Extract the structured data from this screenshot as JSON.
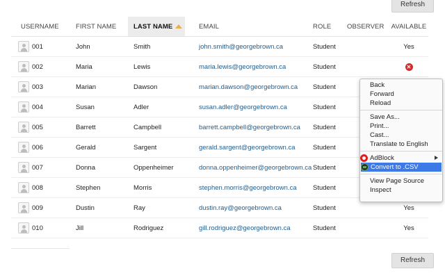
{
  "buttons": {
    "refresh_top": "Refresh",
    "refresh_bottom": "Refresh"
  },
  "table": {
    "headers": {
      "username": "USERNAME",
      "first_name": "FIRST NAME",
      "last_name": "LAST NAME",
      "email": "EMAIL",
      "role": "ROLE",
      "observer": "OBSERVER",
      "available": "AVAILABLE"
    },
    "sorted_column": "last_name",
    "rows": [
      {
        "username": "001",
        "first": "John",
        "last": "Smith",
        "email": "john.smith@georgebrown.ca",
        "role": "Student",
        "observer": "",
        "available": "Yes"
      },
      {
        "username": "002",
        "first": "Maria",
        "last": "Lewis",
        "email": "maria.lewis@georgebrown.ca",
        "role": "Student",
        "observer": "",
        "available": "x-icon"
      },
      {
        "username": "003",
        "first": "Marian",
        "last": "Dawson",
        "email": "marian.dawson@georgebrown.ca",
        "role": "Student",
        "observer": "",
        "available": ""
      },
      {
        "username": "004",
        "first": "Susan",
        "last": "Adler",
        "email": "susan.adler@georgebrown.ca",
        "role": "Student",
        "observer": "",
        "available": ""
      },
      {
        "username": "005",
        "first": "Barrett",
        "last": "Campbell",
        "email": "barrett.campbell@georgebrown.ca",
        "role": "Student",
        "observer": "",
        "available": ""
      },
      {
        "username": "006",
        "first": "Gerald",
        "last": "Sargent",
        "email": "gerald.sargent@georgebrown.ca",
        "role": "Student",
        "observer": "",
        "available": ""
      },
      {
        "username": "007",
        "first": "Donna",
        "last": "Oppenheimer",
        "email": "donna.oppenheimer@georgebrown.ca",
        "role": "Student",
        "observer": "",
        "available": ""
      },
      {
        "username": "008",
        "first": "Stephen",
        "last": "Morris",
        "email": "stephen.morris@georgebrown.ca",
        "role": "Student",
        "observer": "",
        "available": ""
      },
      {
        "username": "009",
        "first": "Dustin",
        "last": "Ray",
        "email": "dustin.ray@georgebrown.ca",
        "role": "Student",
        "observer": "",
        "available": "Yes"
      },
      {
        "username": "010",
        "first": "Jill",
        "last": "Rodriguez",
        "email": "gill.rodriguez@georgebrown.ca",
        "role": "Student",
        "observer": "",
        "available": "Yes"
      }
    ]
  },
  "context_menu": {
    "back": "Back",
    "forward": "Forward",
    "reload": "Reload",
    "save_as": "Save As...",
    "print": "Print...",
    "cast": "Cast...",
    "translate": "Translate to English",
    "adblock": "AdBlock",
    "convert_csv": "Convert to .CSV",
    "view_source": "View Page Source",
    "inspect": "Inspect"
  },
  "colors": {
    "email_link": "#1f5d8f",
    "highlight": "#3d79e7",
    "error": "#d9282a",
    "sort_arrow": "#e8b04a"
  }
}
